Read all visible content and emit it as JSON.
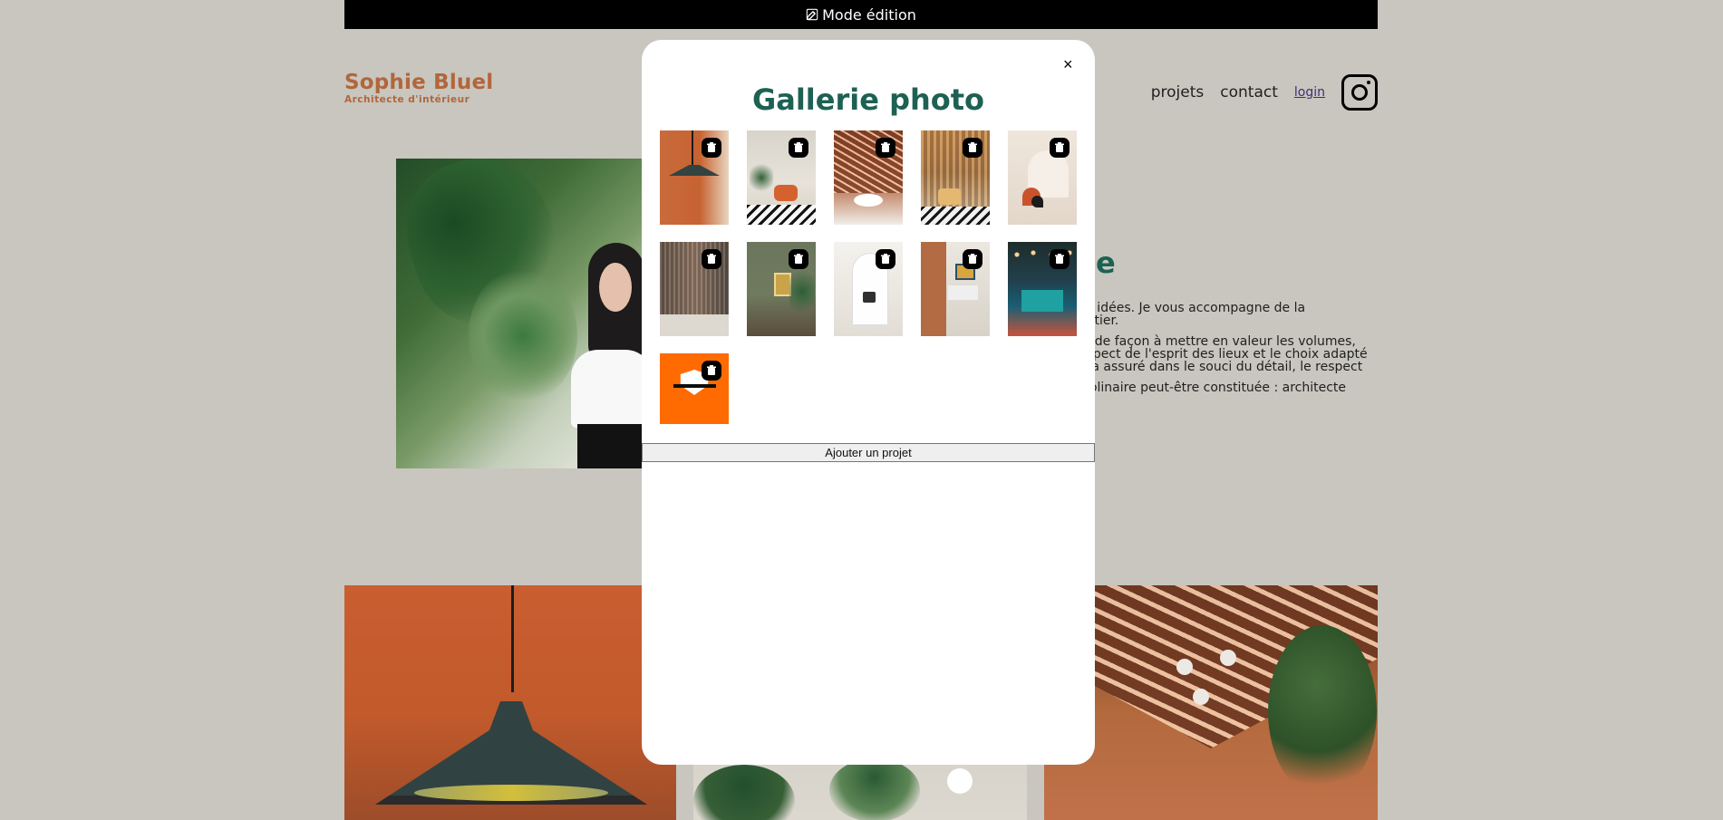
{
  "top_bar": {
    "icon": "edit-icon",
    "label": "Mode édition"
  },
  "brand": {
    "name": "Sophie Bluel",
    "role": "Architecte d'intérieur",
    "color": "#b1663c"
  },
  "nav": {
    "items": [
      {
        "label": "projets"
      },
      {
        "label": "contact"
      },
      {
        "label": "login"
      }
    ],
    "instagram_icon": "instagram-icon"
  },
  "about": {
    "title": "ce",
    "paragraphs": [
      "os idées. Je vous accompagne de la\nantier.",
      "n, de façon à mettre en valeur les volumes,\nespect de l'esprit des lieux et le choix adapté\nera assuré dans le souci du détail, le respect",
      "ciplinaire peut-être constituée : architecte"
    ]
  },
  "modal": {
    "title": "Gallerie photo",
    "close_label": "×",
    "delete_icon": "trash-icon",
    "add_button": "Ajouter un projet"
  },
  "colors": {
    "title_green": "#1d6154",
    "background": "#c8c6be",
    "modal_bg": "#ffffff"
  }
}
